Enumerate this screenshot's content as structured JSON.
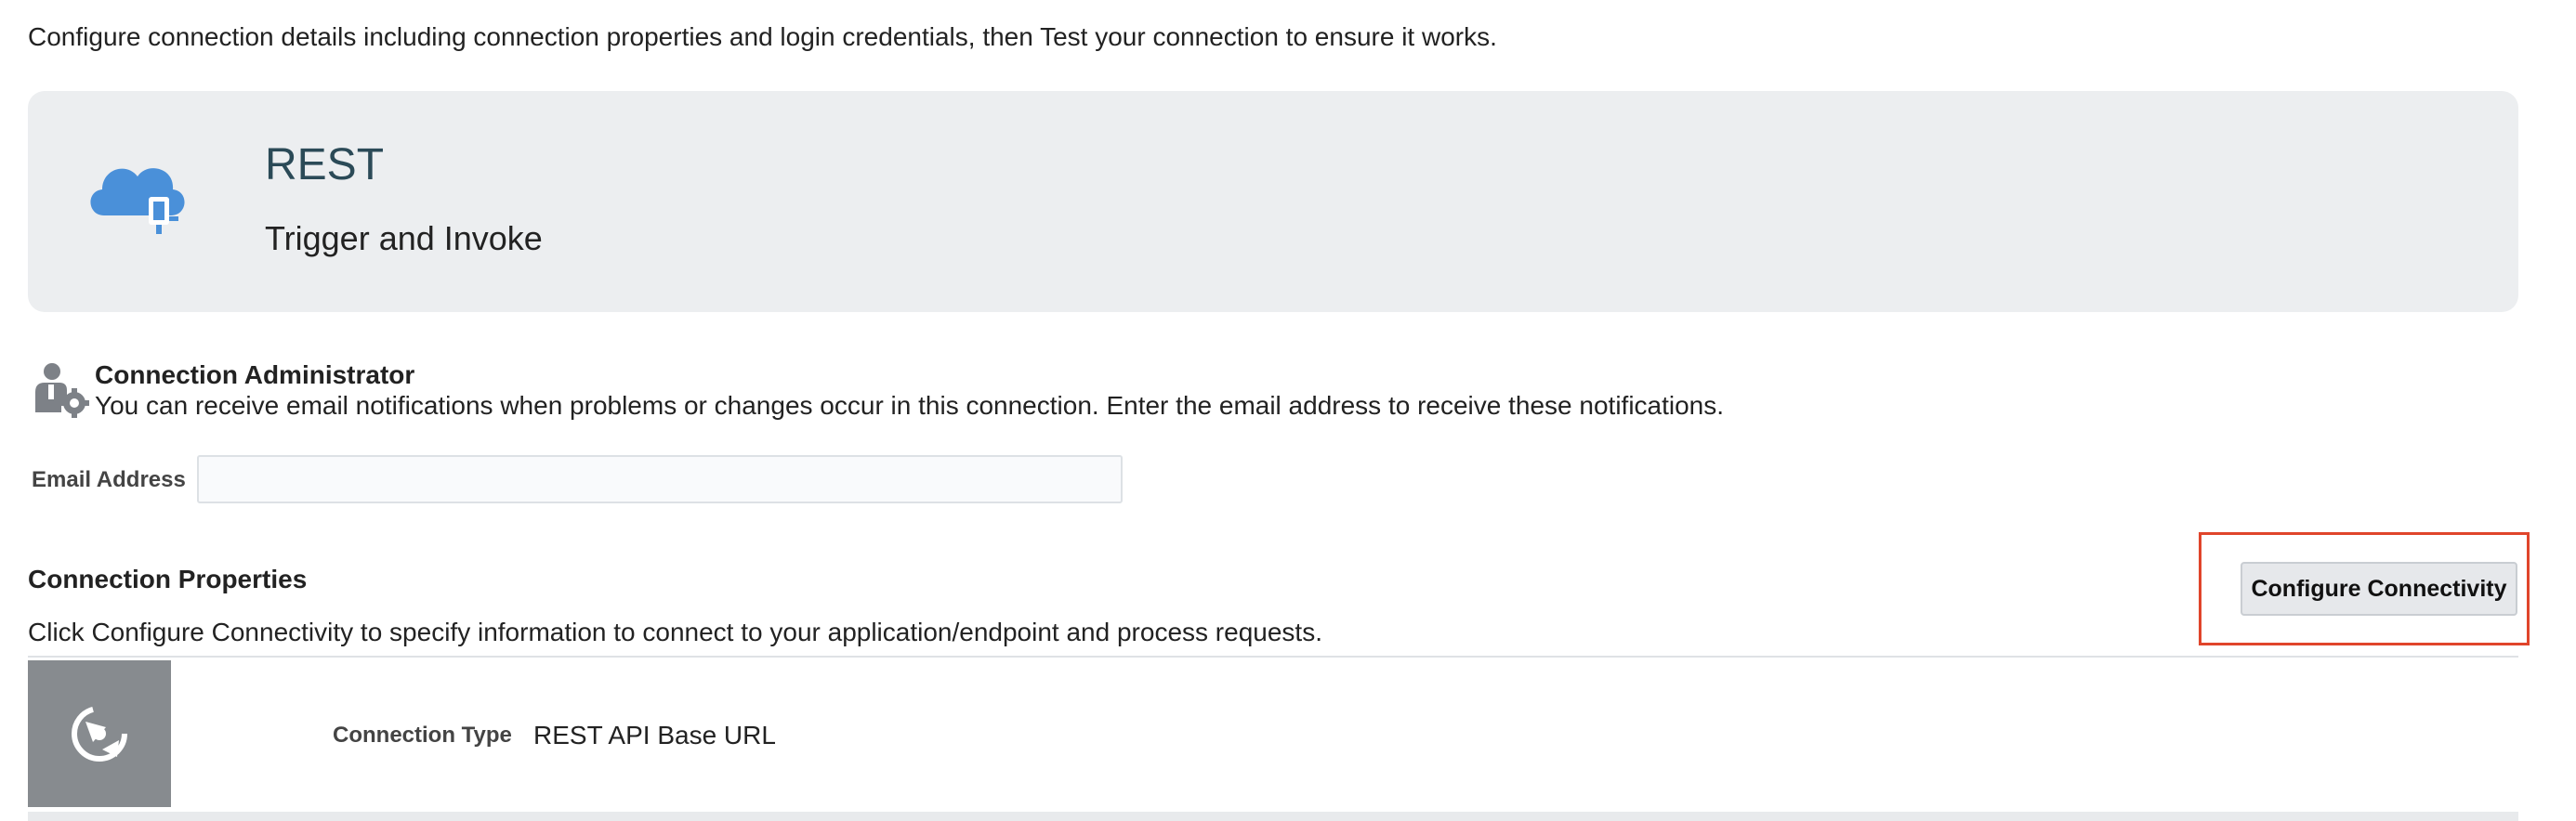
{
  "intro_text": "Configure connection details including connection properties and login credentials, then Test your connection to ensure it works.",
  "banner": {
    "icon": "cloud-plug-icon",
    "title": "REST",
    "subtitle": "Trigger and Invoke"
  },
  "admin": {
    "icon": "user-gear-icon",
    "title": "Connection Administrator",
    "description": "You can receive email notifications when problems or changes occur in this connection. Enter the email address to receive these notifications."
  },
  "email": {
    "label": "Email Address",
    "value": ""
  },
  "connection_properties": {
    "title": "Connection Properties",
    "description": "Click Configure Connectivity to specify information to connect to your application/endpoint and process requests.",
    "button_label": "Configure Connectivity",
    "type_icon": "connectivity-icon",
    "type_label": "Connection Type",
    "type_value": "REST API Base URL"
  },
  "colors": {
    "banner_bg": "#eceef0",
    "title_color": "#2b4a57",
    "icon_blue": "#4a90d9",
    "highlight": "#e0452b",
    "tile_gray": "#878b8f"
  }
}
